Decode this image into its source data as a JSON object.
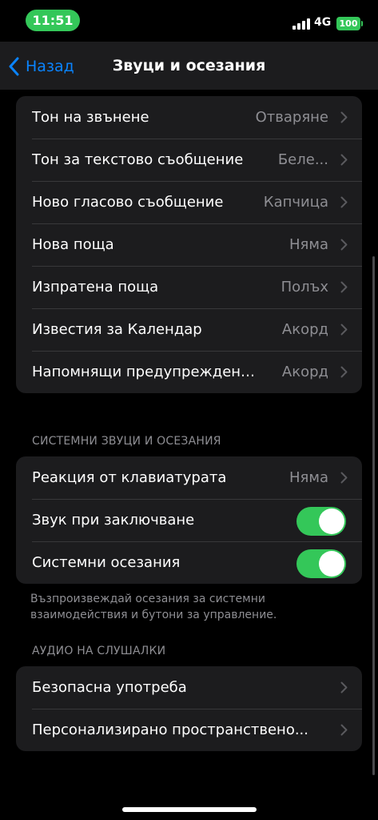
{
  "status": {
    "time": "11:51",
    "network": "4G",
    "battery": "100"
  },
  "nav": {
    "back_label": "Назад",
    "title": "Звуци и осезания"
  },
  "tones": [
    {
      "label": "Тон на звънене",
      "value": "Отваряне"
    },
    {
      "label": "Тон за текстово съобщение",
      "value": "Беле..."
    },
    {
      "label": "Ново гласово съобщение",
      "value": "Капчица"
    },
    {
      "label": "Нова поща",
      "value": "Няма"
    },
    {
      "label": "Изпратена поща",
      "value": "Полъх"
    },
    {
      "label": "Известия за Календар",
      "value": "Акорд"
    },
    {
      "label": "Напомнящи предупреждения",
      "value": "Акорд"
    }
  ],
  "system": {
    "header": "СИСТЕМНИ ЗВУЦИ И ОСЕЗАНИЯ",
    "keyboard_feedback": {
      "label": "Реакция от клавиатурата",
      "value": "Няма"
    },
    "lock_sound": {
      "label": "Звук при заключване",
      "on": true
    },
    "system_haptics": {
      "label": "Системни осезания",
      "on": true
    },
    "footer": "Възпроизвеждай осезания за системни взаимодействия и бутони за управление."
  },
  "headphone": {
    "header": "АУДИО НА СЛУШАЛКИ",
    "safety": {
      "label": "Безопасна употреба"
    },
    "spatial": {
      "label": "Персонализирано пространствено..."
    }
  },
  "colors": {
    "accent": "#0a84ff",
    "toggle_on": "#34c759",
    "cell_bg": "#1c1c1e",
    "secondary_text": "#8e8e93"
  }
}
